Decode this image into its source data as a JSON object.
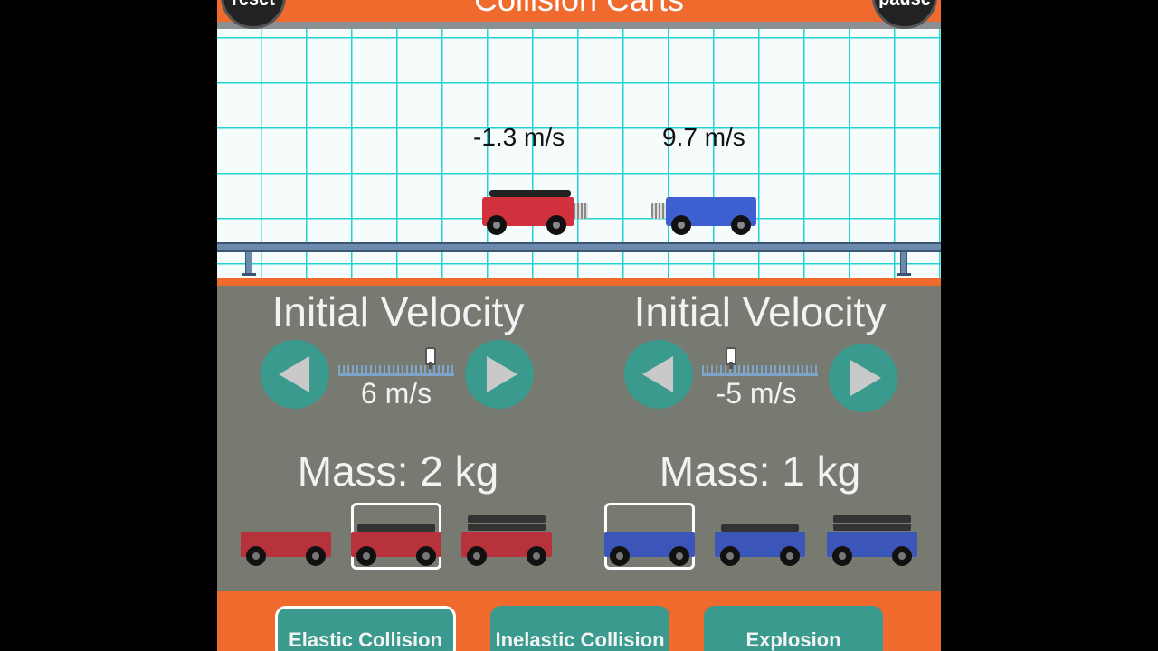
{
  "header": {
    "title": "Collision Carts",
    "reset_label": "reset",
    "pause_label": "pause"
  },
  "track": {
    "cart1_velocity_label": "-1.3 m/s",
    "cart2_velocity_label": "9.7 m/s"
  },
  "cart1": {
    "heading": "Initial Velocity",
    "velocity_value": "6 m/s",
    "mass_label": "Mass: 2 kg",
    "selected_mass_option": 2,
    "color": "#c8323a"
  },
  "cart2": {
    "heading": "Initial Velocity",
    "velocity_value": "-5 m/s",
    "mass_label": "Mass: 1 kg",
    "selected_mass_option": 1,
    "color": "#3c5fc8"
  },
  "modes": {
    "elastic_label": "Elastic Collision",
    "inelastic_label": "Inelastic Collision",
    "explosion_label": "Explosion",
    "active": "Elastic Collision"
  },
  "colors": {
    "accent": "#ef6a2c",
    "button": "#3a9a8e",
    "panel": "#777a70",
    "grid": "#22d3d3"
  }
}
